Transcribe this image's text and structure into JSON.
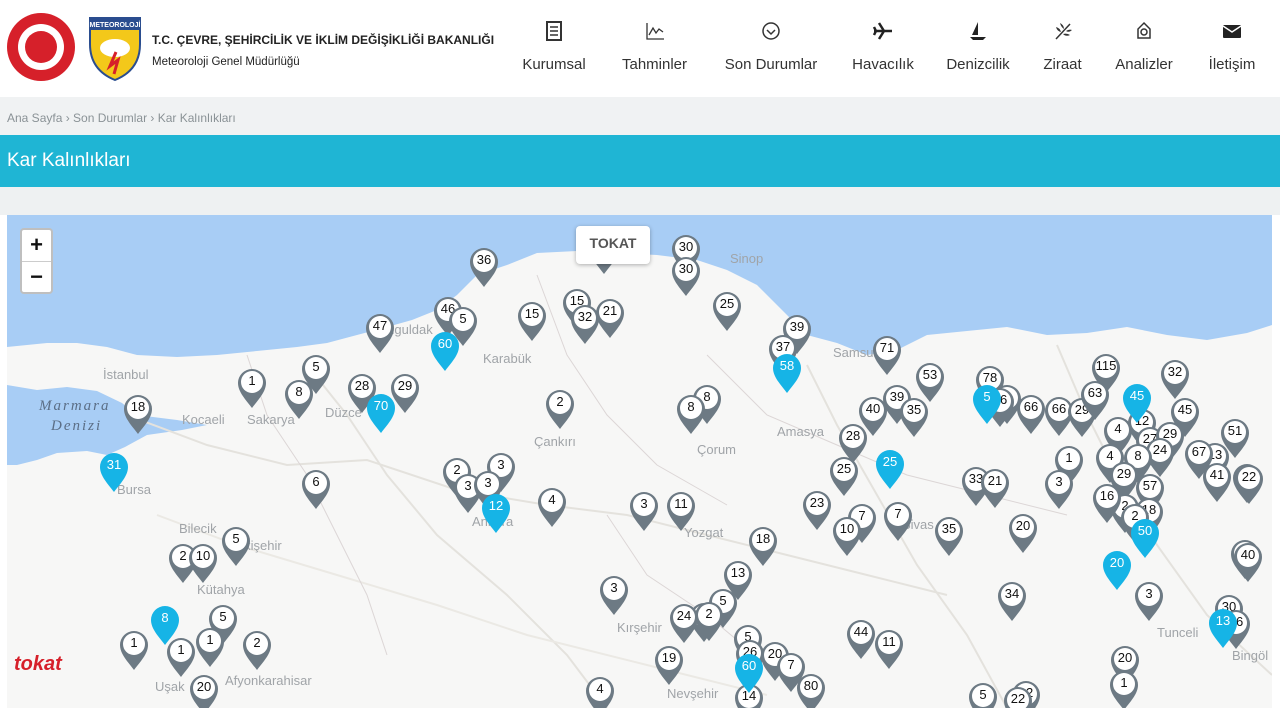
{
  "header": {
    "ministry": "T.C. ÇEVRE, ŞEHİRCİLİK VE İKLİM DEĞİŞİKLİĞİ BAKANLIĞI",
    "subtitle": "Meteoroloji Genel Müdürlüğü",
    "logo_text": "METEOROLOJİ",
    "nav": [
      {
        "label": "Kurumsal",
        "icon": "document-icon"
      },
      {
        "label": "Tahminler",
        "icon": "chart-icon"
      },
      {
        "label": "Son Durumlar",
        "icon": "check-circle-icon"
      },
      {
        "label": "Havacılık",
        "icon": "airplane-icon"
      },
      {
        "label": "Denizcilik",
        "icon": "sailboat-icon"
      },
      {
        "label": "Ziraat",
        "icon": "wheat-icon"
      },
      {
        "label": "Analizler",
        "icon": "analysis-icon"
      },
      {
        "label": "İletişim",
        "icon": "envelope-icon"
      }
    ]
  },
  "breadcrumb": "Ana Sayfa › Son Durumlar › Kar Kalınlıkları",
  "page_title": "Kar Kalınlıkları",
  "map": {
    "zoom_in": "+",
    "zoom_out": "−",
    "tooltip": "TOKAT",
    "sea_labels": [
      "Marmara",
      "Denizi"
    ],
    "place_labels": [
      "İstanbul",
      "Kocaeli",
      "Sakarya",
      "Düzce",
      "Zonguldak",
      "Karabük",
      "Bursa",
      "Bilecik",
      "Eskişehir",
      "Kütahya",
      "Uşak",
      "Afyonkarahisar",
      "Ankara",
      "Çankırı",
      "Çorum",
      "Amasya",
      "Samsun",
      "Sinop",
      "Yozgat",
      "Sivas",
      "Kırşehir",
      "Nevşehir",
      "Tunceli",
      "Bingöl"
    ],
    "markers_gray": [
      "47",
      "36",
      "30",
      "30",
      "15",
      "32",
      "21",
      "15",
      "46",
      "5",
      "47",
      "25",
      "39",
      "37",
      "71",
      "53",
      "78",
      "5",
      "56",
      "66",
      "66",
      "29",
      "115",
      "63",
      "32",
      "45",
      "39",
      "35",
      "40",
      "8",
      "8",
      "2",
      "1",
      "5",
      "8",
      "28",
      "29",
      "18",
      "12",
      "4",
      "4",
      "27",
      "29",
      "24",
      "51",
      "13",
      "67",
      "23",
      "2",
      "3",
      "3",
      "3",
      "28",
      "25",
      "1",
      "8",
      "29",
      "57",
      "41",
      "22",
      "6",
      "4",
      "3",
      "11",
      "23",
      "2",
      "7",
      "7",
      "10",
      "35",
      "33",
      "21",
      "3",
      "16",
      "18",
      "2",
      "20",
      "40",
      "5",
      "2",
      "10",
      "18",
      "13",
      "5",
      "34",
      "3",
      "3",
      "2",
      "5",
      "24",
      "2",
      "44",
      "11",
      "1",
      "5",
      "1",
      "2",
      "1",
      "26",
      "20",
      "7",
      "20",
      "19",
      "80",
      "1",
      "20",
      "4",
      "14",
      "5",
      "12",
      "22",
      "30",
      "36",
      "40"
    ],
    "markers_blue": [
      "60",
      "70",
      "58",
      "31",
      "12",
      "25",
      "5",
      "45",
      "50",
      "20",
      "13",
      "8",
      "60"
    ]
  },
  "colors": {
    "accent": "#1fb5d4",
    "marker_gray": "#6d7a84",
    "marker_blue": "#16b4e6",
    "sea": "#a8cdf5",
    "brand_red": "#d6202a"
  },
  "brand_watermark": "tokat"
}
